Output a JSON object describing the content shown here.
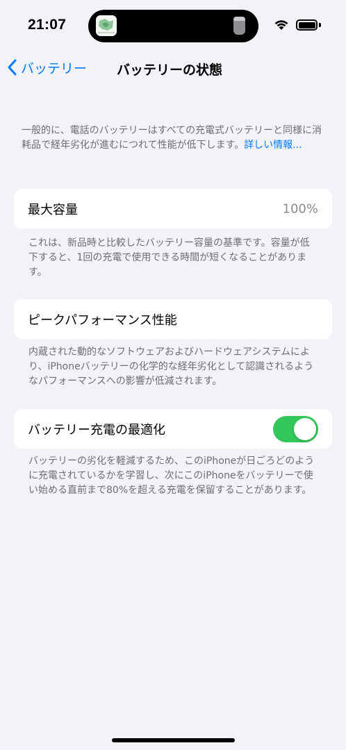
{
  "status_bar": {
    "time": "21:07",
    "icons": [
      "island-app-icon",
      "wifi-icon",
      "battery-icon"
    ]
  },
  "nav": {
    "back_label": "バッテリー",
    "title": "バッテリーの状態"
  },
  "intro": {
    "text": "一般的に、電話のバッテリーはすべての充電式バッテリーと同様に消耗品で経年劣化が進むにつれて性能が低下します。",
    "link": "詳しい情報..."
  },
  "max_capacity": {
    "label": "最大容量",
    "value": "100%",
    "footnote": "これは、新品時と比較したバッテリー容量の基準です。容量が低下すると、1回の充電で使用できる時間が短くなることがあります。"
  },
  "peak_performance": {
    "label": "ピークパフォーマンス性能",
    "footnote": "内蔵された動的なソフトウェアおよびハードウェアシステムにより、iPhoneバッテリーの化学的な経年劣化として認識されるようなパフォーマンスへの影響が低減されます。"
  },
  "optimized_charging": {
    "label": "バッテリー充電の最適化",
    "enabled": true,
    "footnote": "バッテリーの劣化を軽減するため、このiPhoneが日ごろどのように充電されているかを学習し、次にこのiPhoneをバッテリーで使い始める直前まで80%を超える充電を保留することがあります。"
  },
  "colors": {
    "background": "#f2f2f7",
    "accent": "#007aff",
    "toggle_on": "#34c759",
    "secondary_text": "#6d6d72"
  }
}
